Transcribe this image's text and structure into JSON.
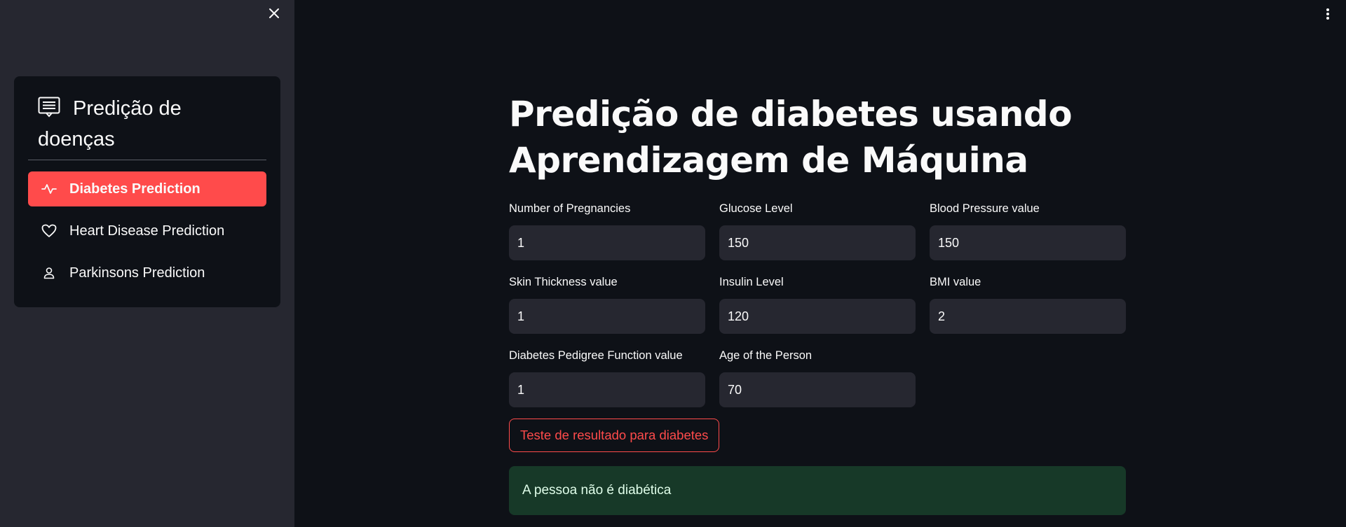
{
  "sidebar": {
    "close_icon": "close-icon",
    "menu": {
      "title": "Predição de doenças",
      "title_icon": "card-list-icon",
      "items": [
        {
          "label": "Diabetes Prediction",
          "icon": "activity-icon",
          "active": true
        },
        {
          "label": "Heart Disease Prediction",
          "icon": "heart-icon",
          "active": false
        },
        {
          "label": "Parkinsons Prediction",
          "icon": "person-icon",
          "active": false
        }
      ]
    }
  },
  "header": {
    "menu_icon": "kebab-menu-icon"
  },
  "main": {
    "title": "Predição de diabetes usando Aprendizagem de Máquina",
    "fields": [
      {
        "label": "Number of Pregnancies",
        "value": "1"
      },
      {
        "label": "Glucose Level",
        "value": "150"
      },
      {
        "label": "Blood Pressure value",
        "value": "150"
      },
      {
        "label": "Skin Thickness value",
        "value": "1"
      },
      {
        "label": "Insulin Level",
        "value": "120"
      },
      {
        "label": "BMI value",
        "value": "2"
      },
      {
        "label": "Diabetes Pedigree Function value",
        "value": "1"
      },
      {
        "label": "Age of the Person",
        "value": "70"
      }
    ],
    "button_label": "Teste de resultado para diabetes",
    "result_text": "A pessoa não é diabética"
  },
  "colors": {
    "accent": "#ff4b4b",
    "background": "#0e1117",
    "sidebar": "#262730",
    "success_bg": "#173928",
    "success_text": "#dffde9"
  }
}
